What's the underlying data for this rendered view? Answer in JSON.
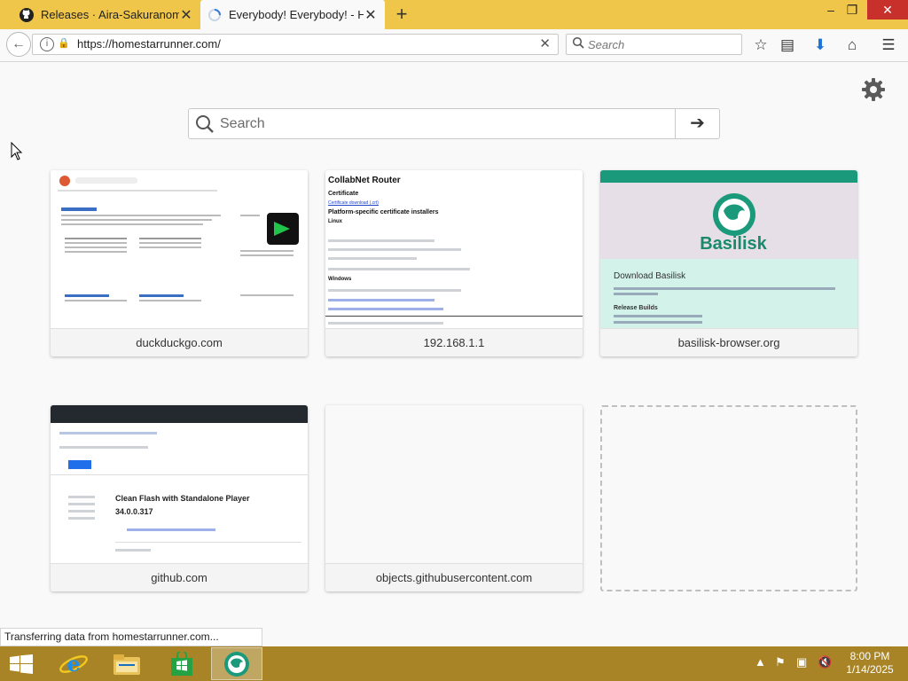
{
  "tabs": [
    {
      "title": "Releases · Aira-Sakuranom"
    },
    {
      "title": "Everybody! Everybody! - Ho"
    }
  ],
  "window_controls": {
    "minimize": "–",
    "restore": "❐",
    "close": "✕"
  },
  "url": "https://homestarrunner.com/",
  "search_placeholder": "Search",
  "newtab_search_placeholder": "Search",
  "tiles": [
    {
      "caption": "duckduckgo.com"
    },
    {
      "caption": "192.168.1.1"
    },
    {
      "caption": "basilisk-browser.org"
    },
    {
      "caption": "github.com"
    },
    {
      "caption": "objects.githubusercontent.com"
    }
  ],
  "thumbs": {
    "collabnet": {
      "title": "CollabNet Router",
      "h_cert": "Certificate",
      "link_cert": "Certificate download (.crt)",
      "h_install": "Platform-specific certificate installers",
      "h_linux": "Linux",
      "h_windows": "Windows"
    },
    "basilisk": {
      "logo_text": "Basilisk",
      "download_title": "Download Basilisk",
      "release_builds": "Release Builds"
    },
    "github": {
      "release_title": "Clean Flash with Standalone Player",
      "version": "34.0.0.317"
    }
  },
  "status_text": "Transferring data from homestarrunner.com...",
  "clock": {
    "time": "8:00 PM",
    "date": "1/14/2025"
  },
  "colors": {
    "titlebar": "#f0c64a",
    "taskbar": "#a88427",
    "basilisk_green": "#1a9a7a"
  }
}
